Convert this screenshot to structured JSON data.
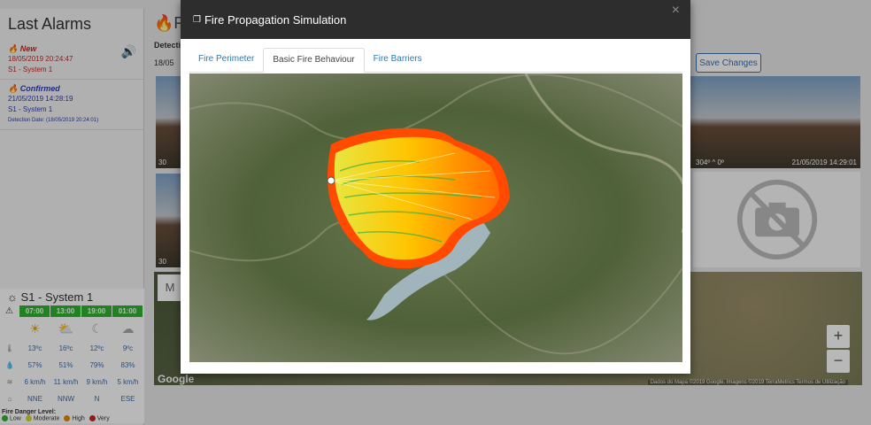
{
  "sidebar": {
    "title": "Last Alarms",
    "alarms": [
      {
        "status": "New",
        "date": "18/05/2019 20:24:47",
        "system": "S1 - System 1",
        "detection": ""
      },
      {
        "status": "Confirmed",
        "date": "21/05/2019 14:28:19",
        "system": "S1 - System 1",
        "detection": "Detection Date: (18/05/2019 20:24:01)"
      }
    ]
  },
  "station": {
    "name": "S1 - System 1",
    "hours": [
      "07:00",
      "13:00",
      "19:00",
      "01:00"
    ],
    "temps": [
      "13ºc",
      "16ºc",
      "12ºc",
      "9ºc"
    ],
    "humidity": [
      "57%",
      "51%",
      "79%",
      "83%"
    ],
    "wind_speed": [
      "6 km/h",
      "11 km/h",
      "9 km/h",
      "5 km/h"
    ],
    "wind_dir": [
      "NNE",
      "NNW",
      "N",
      "ESE"
    ],
    "danger_title": "Fire Danger Level:",
    "danger_levels": [
      {
        "label": "Low",
        "color": "#2fb52f"
      },
      {
        "label": "Moderate",
        "color": "#d6d626"
      },
      {
        "label": "High",
        "color": "#e68a00"
      },
      {
        "label": "Very",
        "color": "#c62828"
      }
    ]
  },
  "main": {
    "header": "Fir",
    "detect_label": "Detecti",
    "detect_date": "18/05",
    "save_button": "Save Changes",
    "cam_top_left_label": "30",
    "cam_bottom_left_label": "30",
    "cam_right_label": "304º",
    "cam_right_tilt": "0º",
    "cam_right_time": "21/05/2019 14:29:01",
    "map_tab": "M",
    "google": "Google",
    "map_footer": "Dados do Mapa ©2019 Google, Imagens ©2019 TerraMetrics   Termos de Utilização",
    "zoom_in": "+",
    "zoom_out": "−"
  },
  "modal": {
    "title": "Fire Propagation Simulation",
    "close": "×",
    "tabs": [
      "Fire Perimeter",
      "Basic Fire Behaviour",
      "Fire Barriers"
    ],
    "active_tab": 1
  },
  "colors": {
    "fire_outer": "#ff4a00",
    "fire_mid": "#ffb400",
    "fire_inner": "#e8e640",
    "water": "#a9bcc9",
    "terrain": "#5b6b44"
  }
}
